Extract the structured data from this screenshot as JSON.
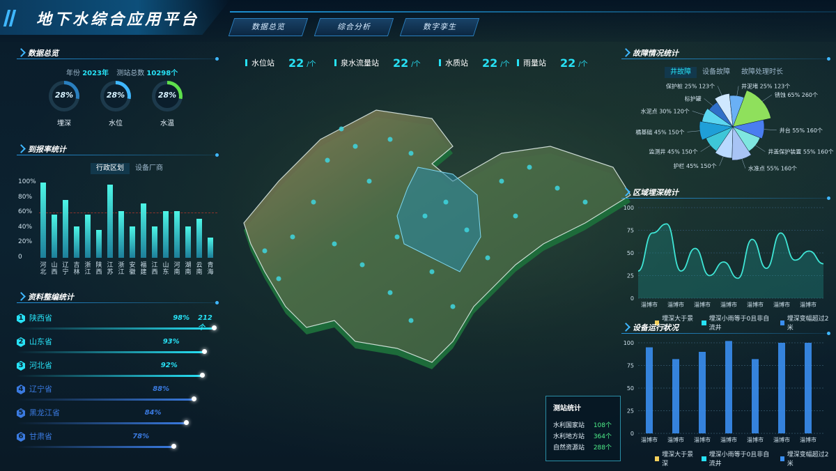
{
  "header": {
    "title": "地下水综合应用平台",
    "nav": [
      "数据总览",
      "综合分析",
      "数字孪生"
    ]
  },
  "overview": {
    "title": "数据总览",
    "year_label": "年份",
    "year_value": "2023年",
    "total_label": "测站总数",
    "total_value": "10298个",
    "rings": [
      {
        "label": "埋深",
        "value": "28%",
        "pct": 28,
        "color": "#2a7fbf"
      },
      {
        "label": "水位",
        "value": "28%",
        "pct": 28,
        "color": "#3fb7ff"
      },
      {
        "label": "水温",
        "value": "28%",
        "pct": 28,
        "color": "#5ee04c"
      }
    ]
  },
  "report_rate": {
    "title": "到报率统计",
    "tabs": [
      "行政区划",
      "设备厂商"
    ],
    "chart_data": {
      "type": "bar",
      "categories": [
        "河北",
        "山西",
        "辽宁",
        "吉林",
        "浙江",
        "陕西",
        "江苏",
        "浙江",
        "安徽",
        "福建",
        "江西",
        "山东",
        "河南",
        "湖南",
        "云南",
        "青海"
      ],
      "values": [
        100,
        57,
        77,
        42,
        57,
        37,
        97,
        62,
        42,
        72,
        42,
        62,
        62,
        42,
        52,
        27
      ],
      "yticks": [
        "100%",
        "80%",
        "60%",
        "40%",
        "20%",
        "0"
      ],
      "ylim": [
        0,
        100
      ]
    }
  },
  "archive": {
    "title": "资料整编统计",
    "items": [
      {
        "num": "1",
        "name": "陕西省",
        "pct": "98%",
        "extra": "212个",
        "value": 98,
        "color": "#27e1f5"
      },
      {
        "num": "2",
        "name": "山东省",
        "pct": "93%",
        "extra": "",
        "value": 93,
        "color": "#27e1f5"
      },
      {
        "num": "3",
        "name": "河北省",
        "pct": "92%",
        "extra": "",
        "value": 92,
        "color": "#27e1f5"
      },
      {
        "num": "4",
        "name": "辽宁省",
        "pct": "88%",
        "extra": "",
        "value": 88,
        "color": "#3a7ae0"
      },
      {
        "num": "5",
        "name": "黑龙江省",
        "pct": "84%",
        "extra": "",
        "value": 84,
        "color": "#3a7ae0"
      },
      {
        "num": "6",
        "name": "甘肃省",
        "pct": "78%",
        "extra": "",
        "value": 78,
        "color": "#3a7ae0"
      }
    ]
  },
  "top_stats": [
    {
      "name": "水位站",
      "value": "22",
      "unit": "/个"
    },
    {
      "name": "泉水流量站",
      "value": "22",
      "unit": "/个"
    },
    {
      "name": "水质站",
      "value": "22",
      "unit": "/个"
    },
    {
      "name": "雨量站",
      "value": "22",
      "unit": "/个"
    }
  ],
  "faults": {
    "title": "故障情况统计",
    "tabs": [
      "井故障",
      "设备故障",
      "故障处理时长"
    ],
    "chart_data": {
      "type": "pie",
      "slices": [
        {
          "label": "锈蚀 65% 260个",
          "value": 260,
          "color": "#8fe05c"
        },
        {
          "label": "井台 55% 160个",
          "value": 160,
          "color": "#4a7ef0"
        },
        {
          "label": "井盖保护装置 55% 160个",
          "value": 160,
          "color": "#7fe6e0"
        },
        {
          "label": "水准点 55% 160个",
          "value": 160,
          "color": "#a8c4f5"
        },
        {
          "label": "护栏 45% 150个",
          "value": 150,
          "color": "#b9d9ff"
        },
        {
          "label": "监测井 45% 150个",
          "value": 150,
          "color": "#3ec6d8"
        },
        {
          "label": "橘基础 45% 150个",
          "value": 150,
          "color": "#1f9fd8"
        },
        {
          "label": "水泥点 30% 120个",
          "value": 120,
          "color": "#5cd6f0"
        },
        {
          "label": "标护罐",
          "value": 100,
          "color": "#2f6fc8"
        },
        {
          "label": "保护桩 25% 123个",
          "value": 123,
          "color": "#cfe8ff"
        },
        {
          "label": "井泥堵 25% 123个",
          "value": 123,
          "color": "#6ab0f5"
        }
      ]
    }
  },
  "depth": {
    "title": "区域埋深统计",
    "chart_data": {
      "type": "area",
      "categories": [
        "淄博市",
        "淄博市",
        "淄博市",
        "淄博市",
        "淄博市",
        "淄博市",
        "淄博市"
      ],
      "yticks": [
        "100",
        "75",
        "50",
        "25",
        "0"
      ],
      "ylim": [
        0,
        100
      ],
      "series": [
        {
          "values": [
            30,
            72,
            82,
            30,
            55,
            25,
            40,
            22,
            65,
            33,
            72,
            42,
            52,
            38
          ]
        }
      ],
      "legend": [
        "埋深大于景深",
        "埋深小雨等于0且非自流井",
        "埋深变幅超过2米"
      ],
      "legend_colors": [
        "#f5d15c",
        "#27e1f5",
        "#3a8ef0"
      ]
    }
  },
  "device": {
    "title": "设备运行状况",
    "chart_data": {
      "type": "bar",
      "categories": [
        "淄博市",
        "淄博市",
        "淄博市",
        "淄博市",
        "淄博市",
        "淄博市",
        "淄博市"
      ],
      "values": [
        95,
        82,
        90,
        102,
        82,
        100,
        100
      ],
      "yticks": [
        "100",
        "75",
        "50",
        "25",
        "0"
      ],
      "ylim": [
        0,
        100
      ],
      "legend": [
        "埋深大于景深",
        "埋深小雨等于0且非自流井",
        "埋深变幅超过2米"
      ],
      "legend_colors": [
        "#f5d15c",
        "#27e1f5",
        "#3a8ef0"
      ]
    }
  },
  "station_box": {
    "title": "测站统计",
    "rows": [
      {
        "label": "水利国家站",
        "value": "108个"
      },
      {
        "label": "水利地方站",
        "value": "364个"
      },
      {
        "label": "自然资源站",
        "value": "288个"
      }
    ]
  }
}
